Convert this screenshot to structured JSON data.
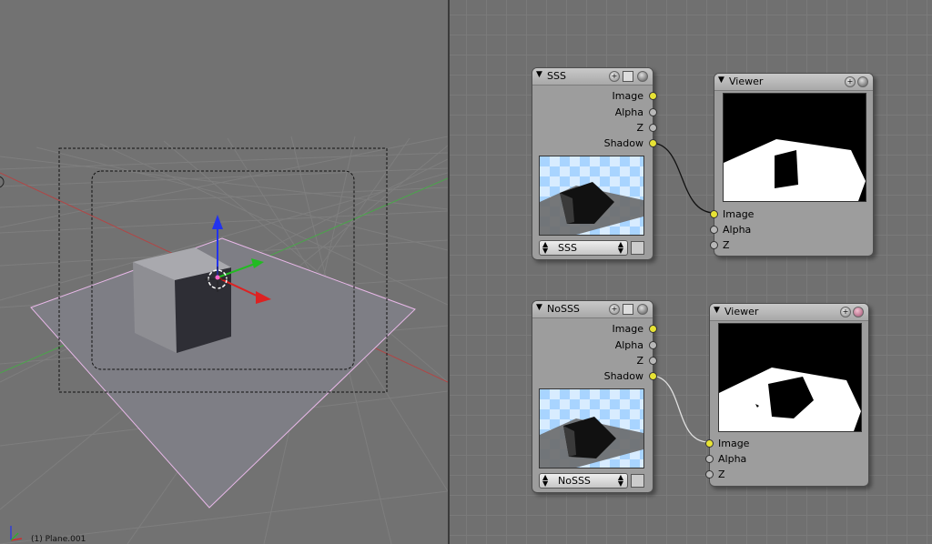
{
  "viewport": {
    "object_label": "(1) Plane.001",
    "colors": {
      "background": "#727272",
      "grid": "#7d7d7d",
      "x_axis": "#b03c3c",
      "y_axis": "#3caa3c"
    }
  },
  "nodes": {
    "sss": {
      "title": "SSS",
      "outputs": [
        "Image",
        "Alpha",
        "Z",
        "Shadow"
      ],
      "scene_name": "SSS"
    },
    "viewer1": {
      "title": "Viewer",
      "inputs": [
        "Image",
        "Alpha",
        "Z"
      ]
    },
    "nosss": {
      "title": "NoSSS",
      "outputs": [
        "Image",
        "Alpha",
        "Z",
        "Shadow"
      ],
      "scene_name": "NoSSS"
    },
    "viewer2": {
      "title": "Viewer",
      "inputs": [
        "Image",
        "Alpha",
        "Z"
      ]
    }
  },
  "icons": {
    "collapse": "triangle-down-icon",
    "plus": "plus-icon",
    "menu": "hamburger-icon",
    "sphere": "sphere-icon",
    "image": "image-icon"
  }
}
